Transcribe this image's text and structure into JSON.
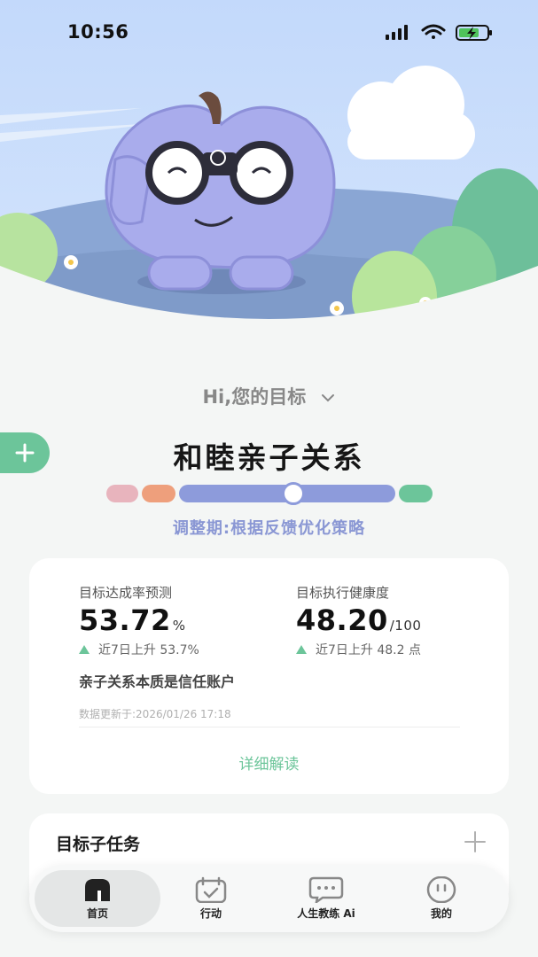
{
  "status_bar": {
    "time": "10:56"
  },
  "goal": {
    "selector_label": "Hi,您的目标",
    "title": "和睦亲子关系",
    "phase_label": "调整期:根据反馈优化策略",
    "colors": {
      "pink": "#e8b4bd",
      "orange": "#ee9f7c",
      "blue": "#8d9bdb",
      "green": "#6cc59a"
    }
  },
  "stats": {
    "achievement": {
      "label": "目标达成率预测",
      "value": "53.72",
      "unit": "%",
      "trend": "近7日上升 53.7%"
    },
    "health": {
      "label": "目标执行健康度",
      "value": "48.20",
      "unit": "/100",
      "trend": "近7日上升 48.2 点"
    },
    "insight": "亲子关系本质是信任账户",
    "updated": "数据更新于:2026/01/26 17:18",
    "detail_link": "详细解读"
  },
  "subtasks": {
    "title": "目标子任务"
  },
  "nav": {
    "items": [
      {
        "label": "首页",
        "icon": "home-icon",
        "active": true
      },
      {
        "label": "行动",
        "icon": "calendar-check-icon",
        "active": false
      },
      {
        "label": "人生教练 Ai",
        "icon": "chat-bubble-icon",
        "active": false
      },
      {
        "label": "我的",
        "icon": "smiley-icon",
        "active": false
      }
    ]
  }
}
